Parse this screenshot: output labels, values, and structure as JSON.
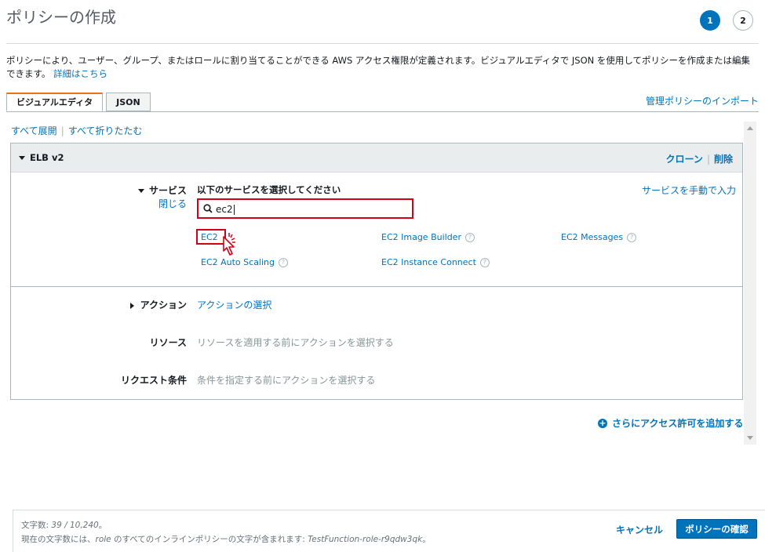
{
  "page": {
    "title": "ポリシーの作成",
    "steps": [
      "1",
      "2"
    ],
    "active_step": 1
  },
  "description": {
    "text": "ポリシーにより、ユーザー、グループ、またはロールに割り当てることができる AWS アクセス権限が定義されます。ビジュアルエディタで JSON を使用してポリシーを作成または編集できます。",
    "link": "詳細はこちら"
  },
  "tabs": [
    {
      "label": "ビジュアルエディタ",
      "active": true
    },
    {
      "label": "JSON",
      "active": false
    }
  ],
  "import_link": "管理ポリシーのインポート",
  "expand_controls": {
    "expand_all": "すべて展開",
    "collapse_all": "すべて折りたたむ"
  },
  "panel": {
    "title": "ELB v2",
    "clone": "クローン",
    "delete": "削除",
    "service": {
      "label": "サービス",
      "close": "閉じる",
      "heading": "以下のサービスを選択してください",
      "manual_link": "サービスを手動で入力",
      "search_value": "ec2",
      "results": [
        {
          "label": "EC2",
          "help": false
        },
        {
          "label": "EC2 Image Builder",
          "help": true
        },
        {
          "label": "EC2 Messages",
          "help": true
        },
        {
          "label": "EC2 Auto Scaling",
          "help": true
        },
        {
          "label": "EC2 Instance Connect",
          "help": true
        }
      ]
    },
    "action": {
      "label": "アクション",
      "link": "アクションの選択"
    },
    "resource": {
      "label": "リソース",
      "text": "リソースを適用する前にアクションを選択する"
    },
    "request": {
      "label": "リクエスト条件",
      "text": "条件を指定する前にアクションを選択する"
    }
  },
  "add_permission": "さらにアクセス許可を追加する",
  "footer": {
    "count_label": "文字数: ",
    "count_value": "39 / 10,240",
    "count_suffix": "。",
    "note_prefix": "現在の文字数には、",
    "note_role": "role",
    "note_middle": " のすべてのインラインポリシーの文字が含まれます: ",
    "note_function": "TestFunction-role-r9qdw3qk",
    "note_suffix": "。",
    "cancel": "キャンセル",
    "review": "ポリシーの確認"
  },
  "colors": {
    "accent": "#0073bb",
    "highlight_red": "#d0021b",
    "tab_active_border": "#ec7211"
  }
}
